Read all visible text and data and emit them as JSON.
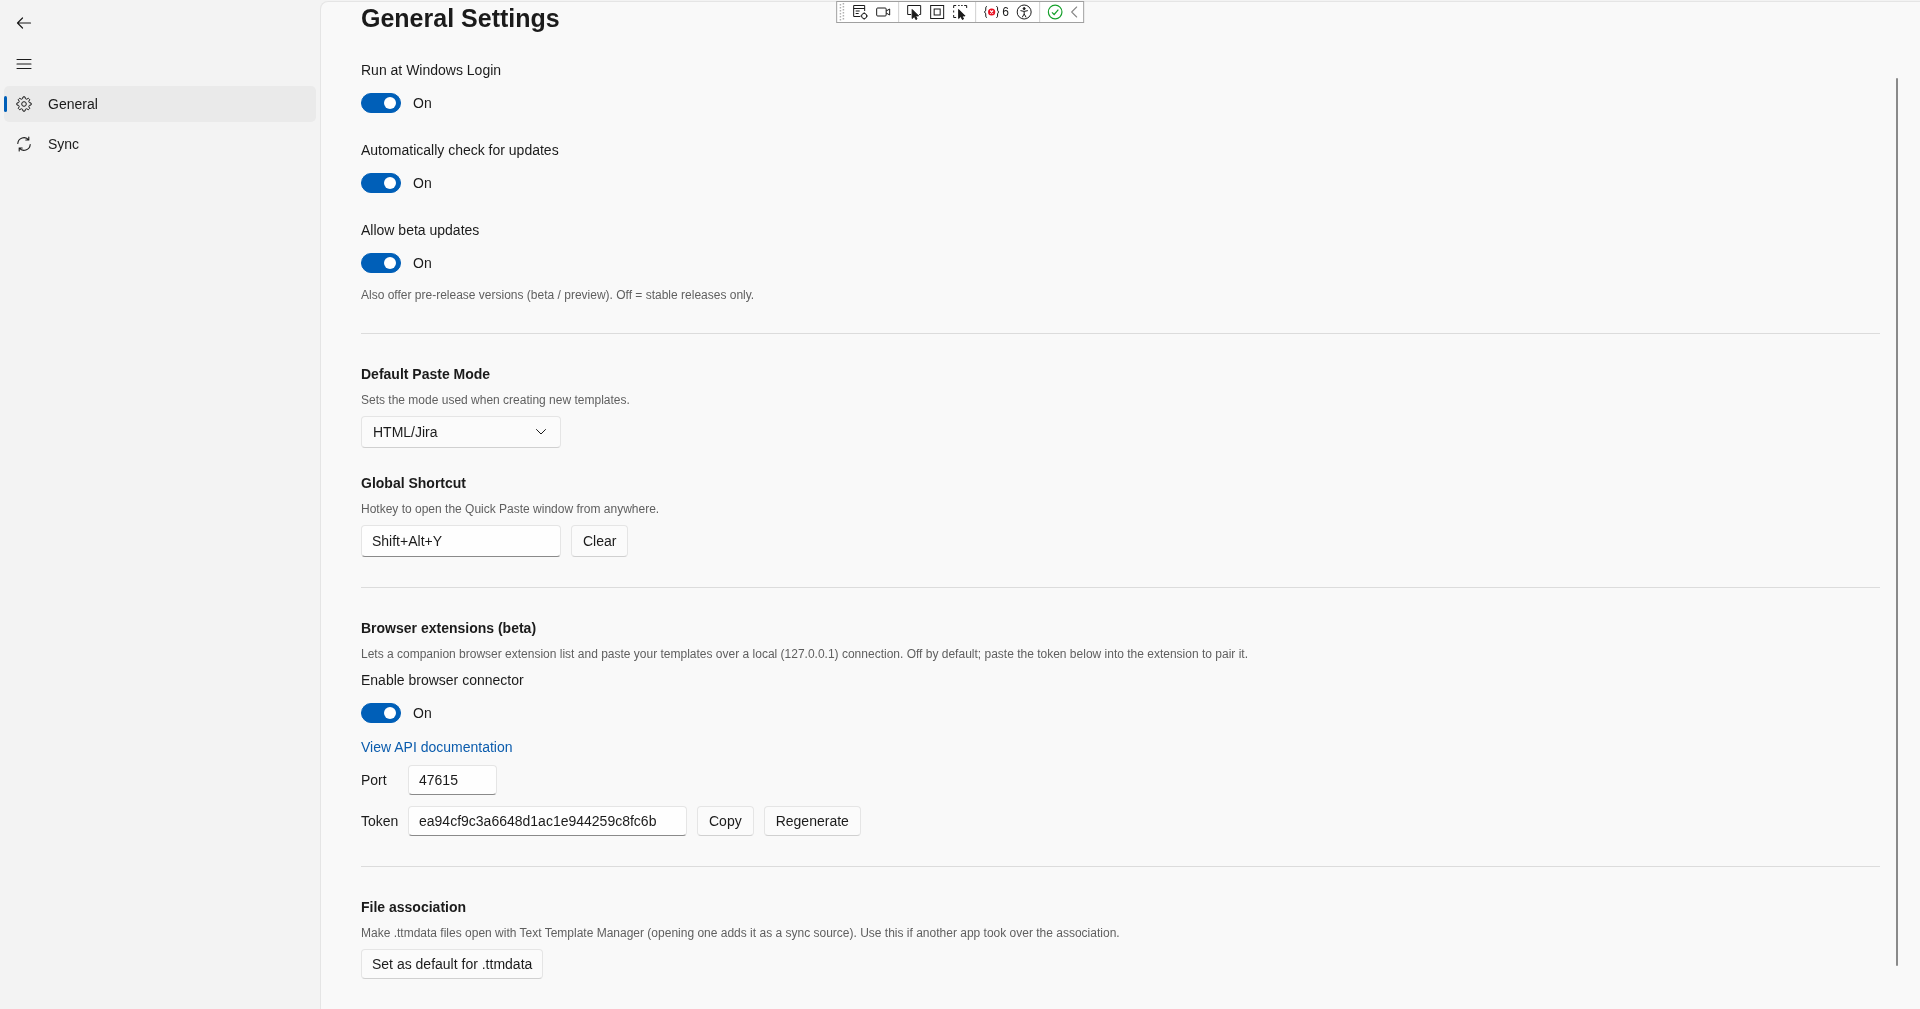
{
  "sidebar": {
    "items": [
      {
        "label": "General",
        "selected": true
      },
      {
        "label": "Sync",
        "selected": false
      }
    ]
  },
  "debug_toolbar": {
    "error_count": "6"
  },
  "page": {
    "title": "General Settings",
    "sections": [
      {
        "items": [
          {
            "kind": "toggle",
            "label": "Run at Windows Login",
            "on": true,
            "state_text": "On"
          },
          {
            "kind": "toggle",
            "label": "Automatically check for updates",
            "on": true,
            "state_text": "On"
          },
          {
            "kind": "toggle",
            "label": "Allow beta updates",
            "on": true,
            "state_text": "On"
          },
          {
            "kind": "note",
            "text": "Also offer pre-release versions (beta / preview). Off = stable releases only."
          }
        ]
      },
      {
        "items": [
          {
            "kind": "heading",
            "text": "Default Paste Mode"
          },
          {
            "kind": "note",
            "text": "Sets the mode used when creating new templates."
          },
          {
            "kind": "dropdown",
            "value": "HTML/Jira"
          },
          {
            "kind": "heading",
            "text": "Global Shortcut"
          },
          {
            "kind": "note",
            "text": "Hotkey to open the Quick Paste window from anywhere."
          },
          {
            "kind": "hotkey",
            "value": "Shift+Alt+Y",
            "buttons": [
              "Clear"
            ]
          }
        ]
      },
      {
        "items": [
          {
            "kind": "heading",
            "text": "Browser extensions (beta)"
          },
          {
            "kind": "note",
            "text": "Lets a companion browser extension list and paste your templates over a local (127.0.0.1) connection. Off by default; paste the token below into the extension to pair it."
          },
          {
            "kind": "toggle",
            "label": "Enable browser connector",
            "on": true,
            "state_text": "On"
          },
          {
            "kind": "link",
            "text": "View API documentation"
          },
          {
            "kind": "field",
            "label": "Port",
            "value": "47615"
          },
          {
            "kind": "field",
            "label": "Token",
            "value": "ea94cf9c3a6648d1ac1e944259c8fc6b",
            "buttons": [
              "Copy",
              "Regenerate"
            ]
          }
        ]
      },
      {
        "items": [
          {
            "kind": "heading",
            "text": "File association"
          },
          {
            "kind": "note",
            "text": "Make .ttmdata files open with Text Template Manager (opening one adds it as a sync source). Use this if another app took over the association."
          },
          {
            "kind": "button",
            "text": "Set as default for .ttmdata"
          }
        ]
      }
    ]
  }
}
